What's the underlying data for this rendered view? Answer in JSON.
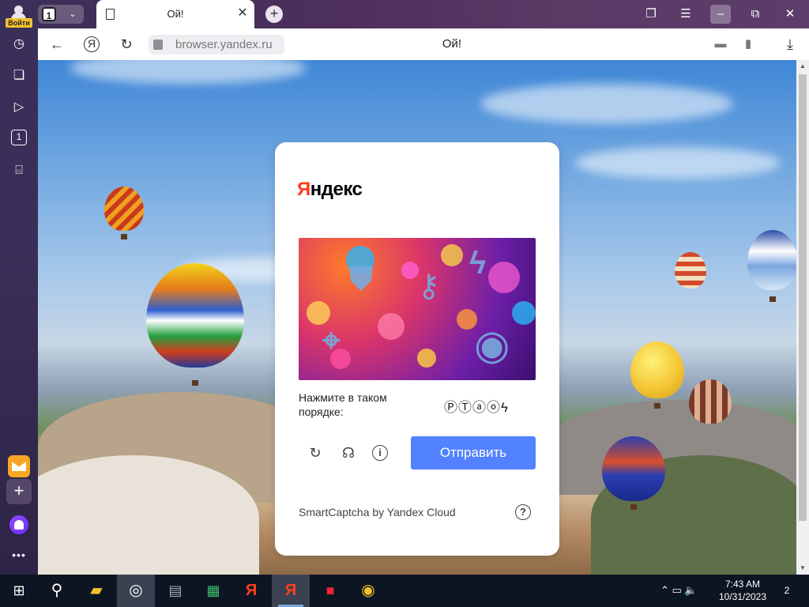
{
  "titlebar": {
    "account_label": "Войти",
    "tabs_count": "1",
    "active_tab_title": "Ой!"
  },
  "addressbar": {
    "yandex_glyph": "Я",
    "url": "browser.yandex.ru",
    "page_title": "Ой!"
  },
  "sidebar": {
    "counter_badge": "1"
  },
  "captcha": {
    "logo_first": "Я",
    "logo_rest": "ндекс",
    "instruction": "Нажмите в таком порядке:",
    "instruction_icons": "ⓅⓉⓐⓞϟ",
    "submit_label": "Отправить",
    "brand": "SmartCaptcha by Yandex Cloud",
    "help_glyph": "?",
    "icons": [
      "reload-icon",
      "headphones-icon",
      "info-icon"
    ]
  },
  "taskbar": {
    "time": "7:43 AM",
    "date": "10/31/2023",
    "notifications": "2"
  }
}
